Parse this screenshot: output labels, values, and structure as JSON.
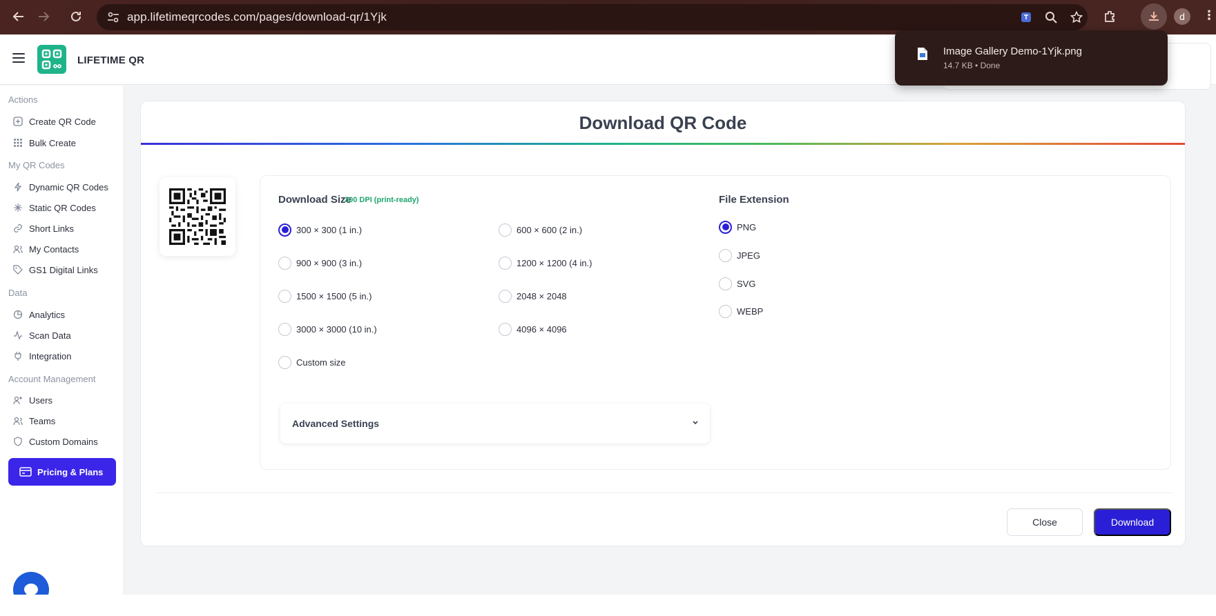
{
  "browser": {
    "url": "app.lifetimeqrcodes.com/pages/download-qr/1Yjk",
    "profile_initial": "d"
  },
  "app": {
    "brand": "LIFETIME QR"
  },
  "sidebar": {
    "sections": [
      {
        "label": "Actions",
        "items": [
          {
            "label": "Create QR Code",
            "icon": "plus-square-icon"
          },
          {
            "label": "Bulk Create",
            "icon": "grid-icon"
          }
        ]
      },
      {
        "label": "My QR Codes",
        "items": [
          {
            "label": "Dynamic QR Codes",
            "icon": "bolt-icon"
          },
          {
            "label": "Static QR Codes",
            "icon": "sparkle-icon"
          },
          {
            "label": "Short Links",
            "icon": "link-icon"
          },
          {
            "label": "My Contacts",
            "icon": "contacts-icon"
          },
          {
            "label": "GS1 Digital Links",
            "icon": "tag-icon"
          }
        ]
      },
      {
        "label": "Data",
        "items": [
          {
            "label": "Analytics",
            "icon": "pie-chart-icon"
          },
          {
            "label": "Scan Data",
            "icon": "activity-icon"
          },
          {
            "label": "Integration",
            "icon": "plug-icon"
          }
        ]
      },
      {
        "label": "Account Management",
        "items": [
          {
            "label": "Users",
            "icon": "user-plus-icon"
          },
          {
            "label": "Teams",
            "icon": "users-icon"
          },
          {
            "label": "Custom Domains",
            "icon": "shield-icon"
          }
        ]
      }
    ],
    "pricing_label": "Pricing & Plans"
  },
  "dialog": {
    "title": "Download QR Code",
    "size_label": "Download Size",
    "dpi_tag": "300 DPI (print-ready)",
    "sizes": [
      "300 × 300 (1 in.)",
      "600 × 600 (2 in.)",
      "900 × 900 (3 in.)",
      "1200 × 1200 (4 in.)",
      "1500 × 1500 (5 in.)",
      "2048 × 2048",
      "3000 × 3000 (10 in.)",
      "4096 × 4096",
      "Custom size"
    ],
    "selected_size": "300 × 300 (1 in.)",
    "ext_label": "File Extension",
    "extensions": [
      "PNG",
      "JPEG",
      "SVG",
      "WEBP"
    ],
    "selected_ext": "PNG",
    "advanced_label": "Advanced Settings",
    "close_label": "Close",
    "download_label": "Download"
  },
  "download_popup": {
    "filename": "Image Gallery Demo-1Yjk.png",
    "status": "14.7 KB • Done"
  },
  "colors": {
    "accent": "#2a1fd6",
    "brand_green": "#1fb38a",
    "pricing": "#3b25e9"
  }
}
